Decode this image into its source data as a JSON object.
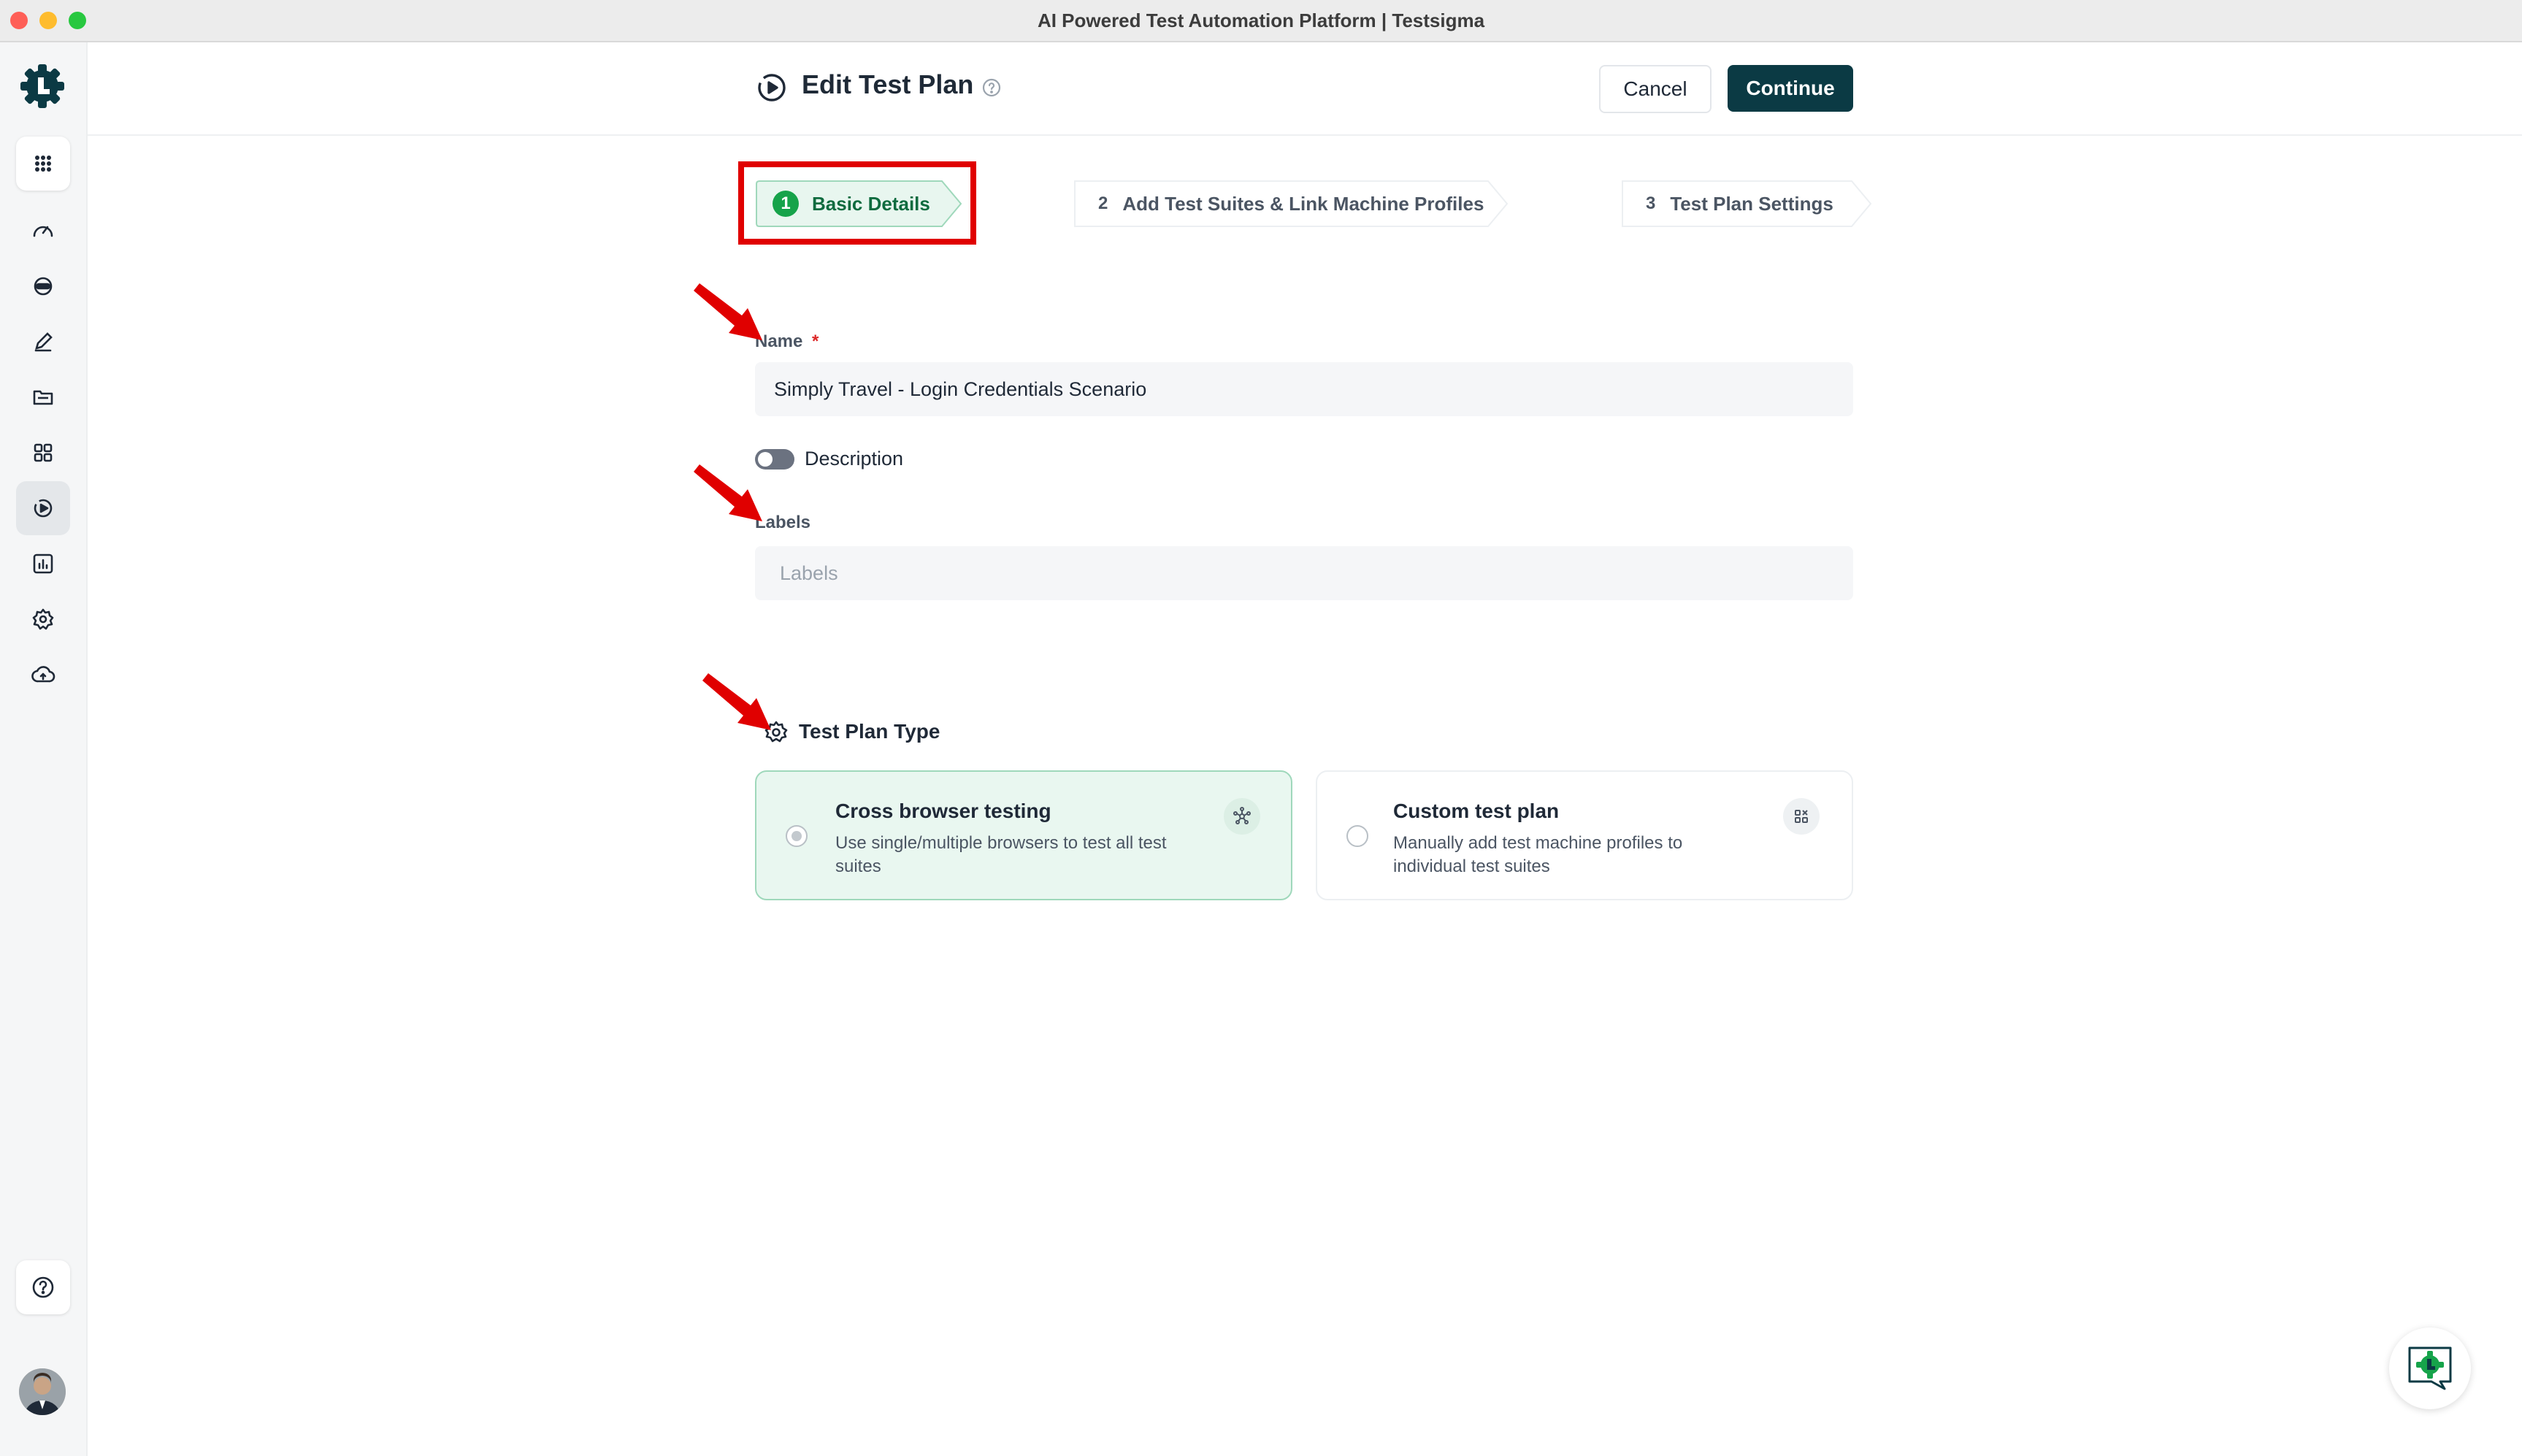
{
  "window": {
    "title": "AI Powered Test Automation Platform | Testsigma"
  },
  "header": {
    "title": "Edit Test Plan",
    "cancel_label": "Cancel",
    "continue_label": "Continue"
  },
  "stepper": {
    "steps": [
      {
        "number": "1",
        "label": "Basic Details"
      },
      {
        "number": "2",
        "label": "Add Test Suites & Link Machine Profiles"
      },
      {
        "number": "3",
        "label": "Test Plan Settings"
      }
    ]
  },
  "form": {
    "name_label": "Name",
    "required_marker": "*",
    "name_value": "Simply Travel - Login Credentials Scenario",
    "description_label": "Description",
    "labels_label": "Labels",
    "labels_placeholder": "Labels",
    "plan_type_title": "Test Plan Type",
    "plan_types": [
      {
        "title": "Cross browser testing",
        "description": "Use single/multiple browsers to test all test suites"
      },
      {
        "title": "Custom test plan",
        "description": "Manually add test machine profiles to individual test suites"
      }
    ]
  },
  "colors": {
    "brand_dark": "#0b3a44",
    "accent_green": "#16a34a",
    "annotation_red": "#e00000"
  }
}
